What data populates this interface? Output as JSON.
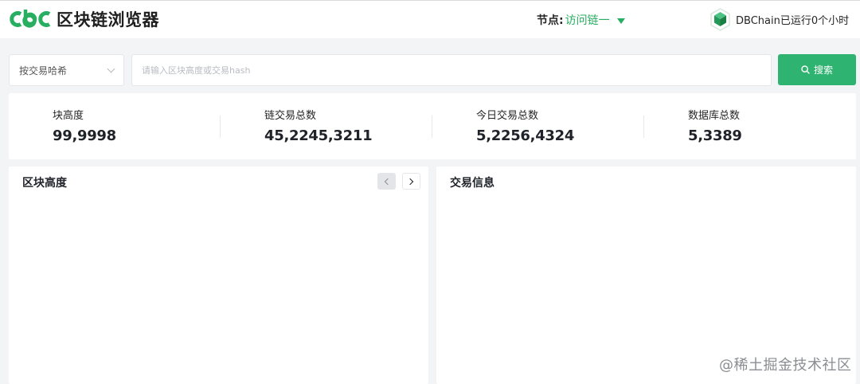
{
  "header": {
    "logo_mark_text": "cbc",
    "title": "区块链浏览器",
    "node_label": "节点:",
    "node_value": "访问链一",
    "status_text": "DBChain已运行0个小时"
  },
  "search": {
    "select_value": "按交易哈希",
    "placeholder": "请输入区块高度或交易hash",
    "button_label": "搜索"
  },
  "stats": [
    {
      "label": "块高度",
      "value": "99,9998"
    },
    {
      "label": "链交易总数",
      "value": "45,2245,3211"
    },
    {
      "label": "今日交易总数",
      "value": "5,2256,4324"
    },
    {
      "label": "数据库总数",
      "value": "5,3389"
    }
  ],
  "panels": {
    "blocks_title": "区块高度",
    "transactions_title": "交易信息"
  },
  "watermark": "@稀土掘金技术社区",
  "colors": {
    "brand_green": "#27ae60",
    "button_green": "#2eb470",
    "background": "#f3f4f6"
  }
}
